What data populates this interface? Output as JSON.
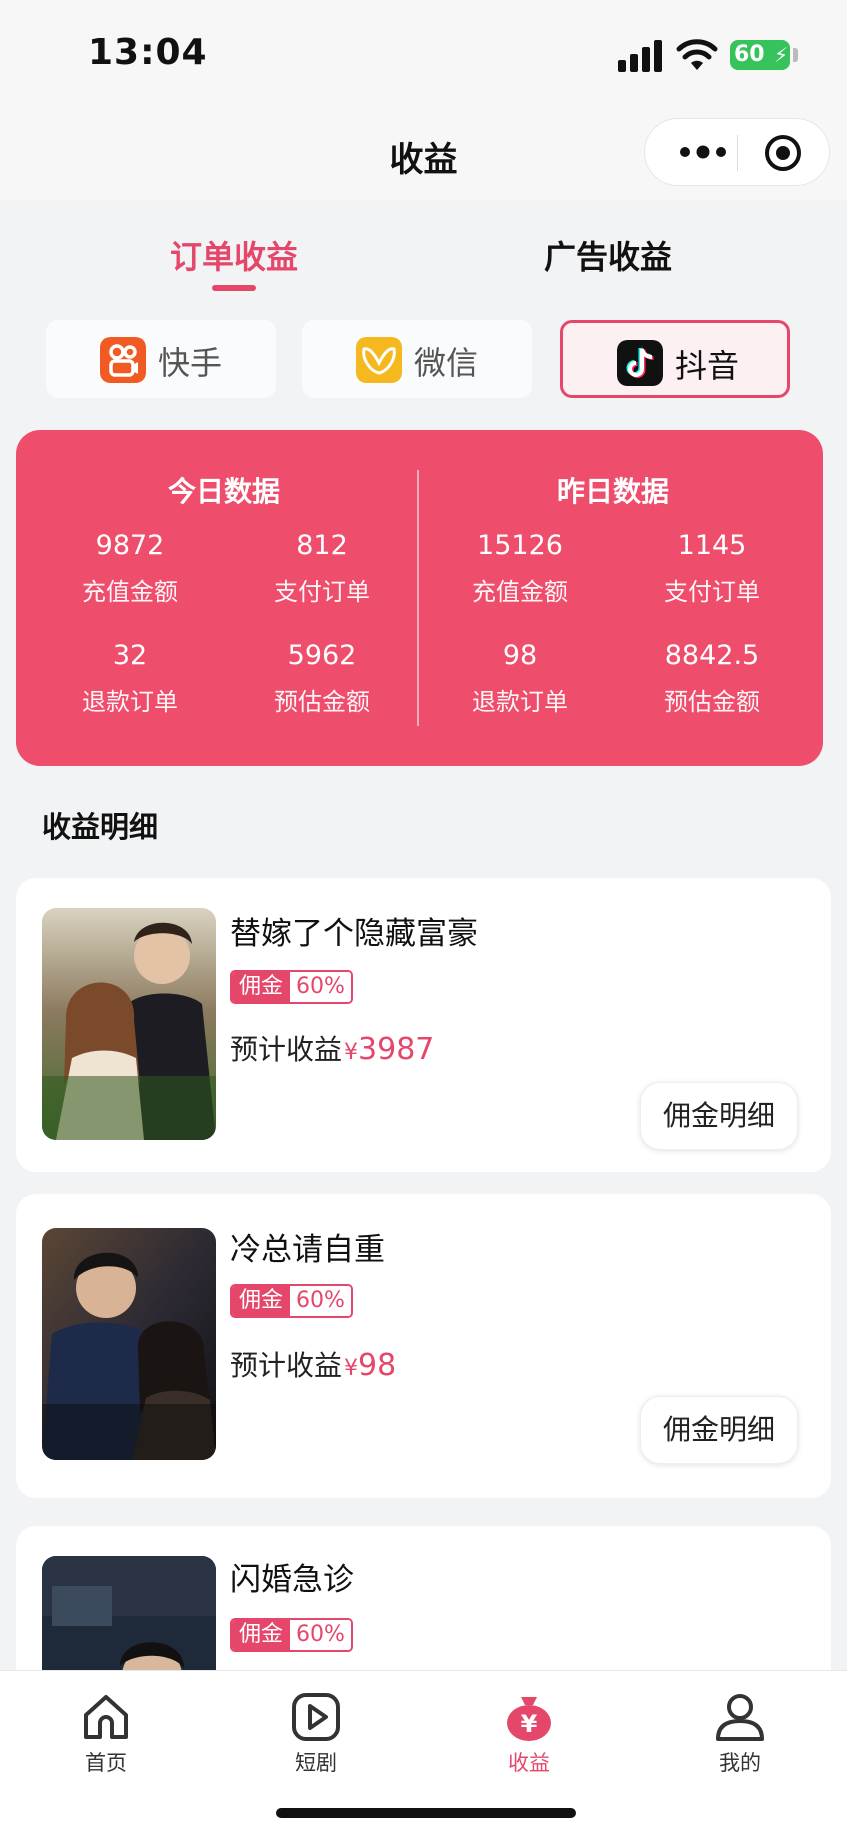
{
  "status_bar": {
    "time": "13:04",
    "battery": "60"
  },
  "nav": {
    "title": "收益"
  },
  "tabs": [
    {
      "label": "订单收益",
      "active": true
    },
    {
      "label": "广告收益",
      "active": false
    }
  ],
  "platforms": [
    {
      "label": "快手",
      "icon": "kuaishou-icon",
      "color": "#f25a23",
      "active": false
    },
    {
      "label": "微信",
      "icon": "wechat-icon",
      "color": "#f5b81f",
      "active": false
    },
    {
      "label": "抖音",
      "icon": "douyin-icon",
      "color": "#111111",
      "active": true
    }
  ],
  "stats": {
    "today": {
      "title": "今日数据",
      "items": [
        {
          "value": "9872",
          "label": "充值金额"
        },
        {
          "value": "812",
          "label": "支付订单"
        },
        {
          "value": "32",
          "label": "退款订单"
        },
        {
          "value": "5962",
          "label": "预估金额"
        }
      ]
    },
    "yesterday": {
      "title": "昨日数据",
      "items": [
        {
          "value": "15126",
          "label": "充值金额"
        },
        {
          "value": "1145",
          "label": "支付订单"
        },
        {
          "value": "98",
          "label": "退款订单"
        },
        {
          "value": "8842.5",
          "label": "预估金额"
        }
      ]
    }
  },
  "section_title": "收益明细",
  "dramas": [
    {
      "title": "替嫁了个隐藏富豪",
      "commission_key": "佣金",
      "commission_value": "60%",
      "earn_label": "预计收益",
      "currency": "¥",
      "amount": "3987",
      "button": "佣金明细"
    },
    {
      "title": "冷总请自重",
      "commission_key": "佣金",
      "commission_value": "60%",
      "earn_label": "预计收益",
      "currency": "¥",
      "amount": "98",
      "button": "佣金明细"
    },
    {
      "title": "闪婚急诊",
      "commission_key": "佣金",
      "commission_value": "60%"
    }
  ],
  "tabbar": [
    {
      "label": "首页",
      "icon": "home-icon",
      "active": false
    },
    {
      "label": "短剧",
      "icon": "play-icon",
      "active": false
    },
    {
      "label": "收益",
      "icon": "money-bag-icon",
      "active": true
    },
    {
      "label": "我的",
      "icon": "user-icon",
      "active": false
    }
  ],
  "colors": {
    "accent": "#e5476b",
    "stats_bg": "#ee4d6c"
  }
}
